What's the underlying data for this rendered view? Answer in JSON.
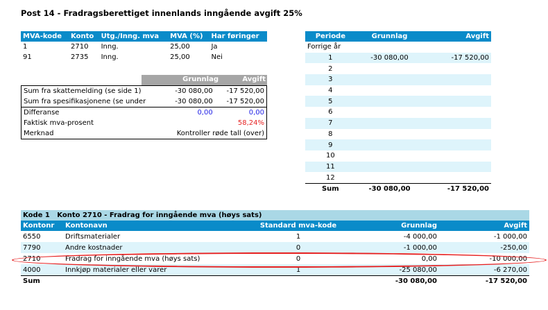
{
  "title": "Post 14 - Fradragsberettiget innenlands inngående avgift 25%",
  "codes": {
    "headers": [
      "MVA-kode",
      "Konto",
      "Utg./Inng. mva",
      "MVA (%)",
      "Har føringer"
    ],
    "rows": [
      [
        "1",
        "2710",
        "Inng.",
        "25,00",
        "Ja"
      ],
      [
        "91",
        "2735",
        "Inng.",
        "25,00",
        "Nei"
      ]
    ]
  },
  "summary": {
    "headers": [
      "Grunnlag",
      "Avgift"
    ],
    "rows": [
      {
        "label": "Sum fra skattemelding (se side 1)",
        "g": "-30 080,00",
        "a": "-17 520,00"
      },
      {
        "label": "Sum fra spesifikasjonene (se under",
        "g": "-30 080,00",
        "a": "-17 520,00"
      },
      {
        "label": "Differanse",
        "g": "0,00",
        "a": "0,00"
      },
      {
        "label": "Faktisk mva-prosent",
        "g": "",
        "a": "58,24%"
      },
      {
        "label": "Merknad",
        "g": "",
        "a": "Kontroller røde tall (over)"
      }
    ]
  },
  "periods": {
    "headers": [
      "Periode",
      "Grunnlag",
      "Avgift"
    ],
    "prev": "Forrige år",
    "rows": [
      [
        "1",
        "-30 080,00",
        "-17 520,00"
      ],
      [
        "2",
        "",
        ""
      ],
      [
        "3",
        "",
        ""
      ],
      [
        "4",
        "",
        ""
      ],
      [
        "5",
        "",
        ""
      ],
      [
        "6",
        "",
        ""
      ],
      [
        "7",
        "",
        ""
      ],
      [
        "8",
        "",
        ""
      ],
      [
        "9",
        "",
        ""
      ],
      [
        "10",
        "",
        ""
      ],
      [
        "11",
        "",
        ""
      ],
      [
        "12",
        "",
        ""
      ]
    ],
    "sum": [
      "Sum",
      "-30 080,00",
      "-17 520,00"
    ]
  },
  "detail": {
    "title": "Kode 1   Konto 2710 - Fradrag for inngående mva (høys sats)",
    "headers": [
      "Kontonr",
      "Kontonavn",
      "Standard mva-kode",
      "Grunnlag",
      "Avgift"
    ],
    "rows": [
      [
        "6550",
        "Driftsmaterialer",
        "1",
        "-4 000,00",
        "-1 000,00"
      ],
      [
        "7790",
        "Andre kostnader",
        "0",
        "-1 000,00",
        "-250,00"
      ],
      [
        "2710",
        "Fradrag for inngående mva (høys sats)",
        "0",
        "0,00",
        "-10 000,00"
      ],
      [
        "4000",
        "Innkjøp materialer eller varer",
        "1",
        "-25 080,00",
        "-6 270,00"
      ]
    ],
    "sum": [
      "Sum",
      "-30 080,00",
      "-17 520,00"
    ]
  },
  "highlight_color": "#e62020"
}
